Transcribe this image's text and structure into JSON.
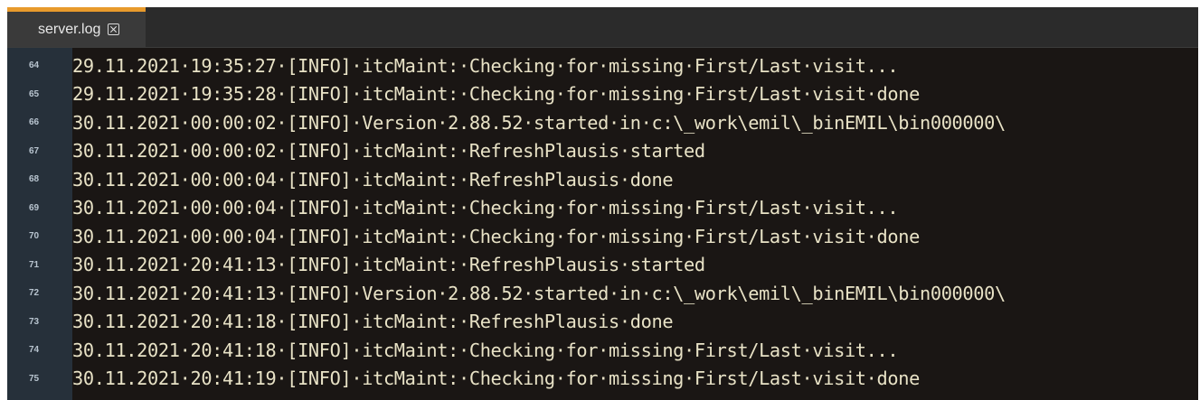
{
  "tab": {
    "label": "server.log",
    "close_label": "close-tab"
  },
  "lines": [
    {
      "no": "64",
      "text": "29.11.2021·19:35:27·[INFO]·itcMaint:·Checking·for·missing·First/Last·visit..."
    },
    {
      "no": "65",
      "text": "29.11.2021·19:35:28·[INFO]·itcMaint:·Checking·for·missing·First/Last·visit·done"
    },
    {
      "no": "66",
      "text": "30.11.2021·00:00:02·[INFO]·Version·2.88.52·started·in·c:\\_work\\emil\\_binEMIL\\bin000000\\"
    },
    {
      "no": "67",
      "text": "30.11.2021·00:00:02·[INFO]·itcMaint:·RefreshPlausis·started"
    },
    {
      "no": "68",
      "text": "30.11.2021·00:00:04·[INFO]·itcMaint:·RefreshPlausis·done"
    },
    {
      "no": "69",
      "text": "30.11.2021·00:00:04·[INFO]·itcMaint:·Checking·for·missing·First/Last·visit..."
    },
    {
      "no": "70",
      "text": "30.11.2021·00:00:04·[INFO]·itcMaint:·Checking·for·missing·First/Last·visit·done"
    },
    {
      "no": "71",
      "text": "30.11.2021·20:41:13·[INFO]·itcMaint:·RefreshPlausis·started"
    },
    {
      "no": "72",
      "text": "30.11.2021·20:41:13·[INFO]·Version·2.88.52·started·in·c:\\_work\\emil\\_binEMIL\\bin000000\\"
    },
    {
      "no": "73",
      "text": "30.11.2021·20:41:18·[INFO]·itcMaint:·RefreshPlausis·done"
    },
    {
      "no": "74",
      "text": "30.11.2021·20:41:18·[INFO]·itcMaint:·Checking·for·missing·First/Last·visit..."
    },
    {
      "no": "75",
      "text": "30.11.2021·20:41:19·[INFO]·itcMaint:·Checking·for·missing·First/Last·visit·done"
    }
  ],
  "colors": {
    "tab_accent": "#e89a2c",
    "editor_bg": "#1a1614",
    "gutter_bg": "#26303a",
    "text": "#e8e2c6"
  }
}
